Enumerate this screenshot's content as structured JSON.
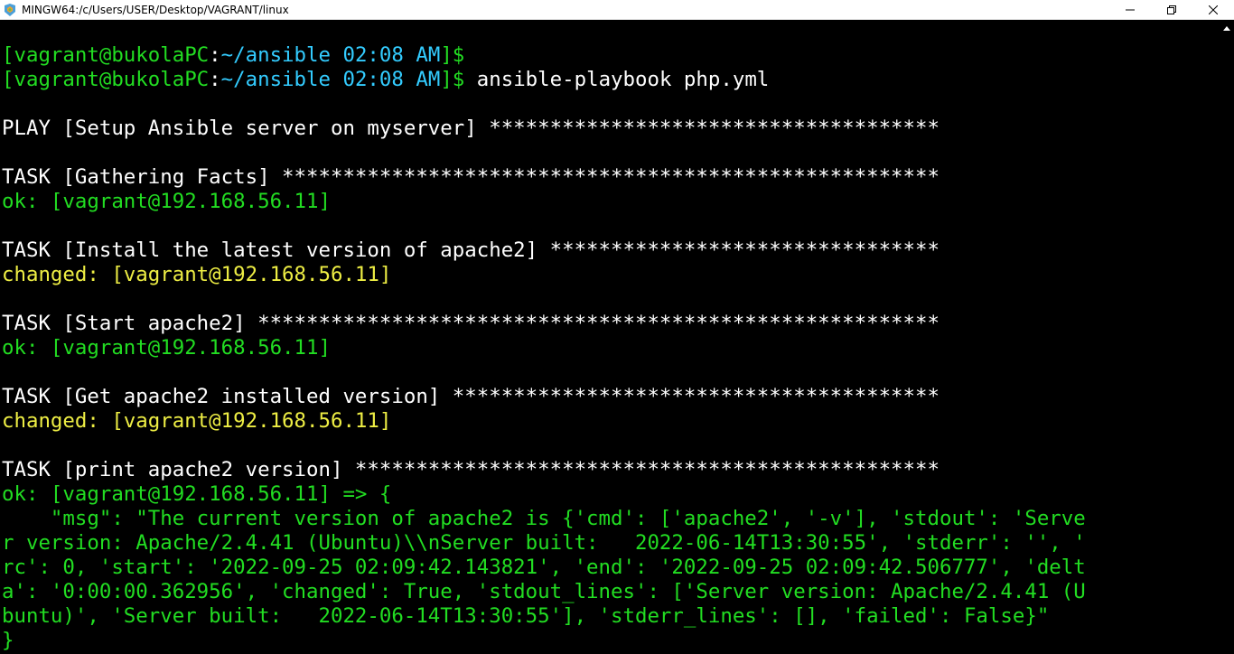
{
  "window": {
    "title": "MINGW64:/c/Users/USER/Desktop/VAGRANT/linux",
    "icon": "mingw-terminal-icon",
    "controls": [
      "minimize-icon",
      "restore-icon",
      "close-icon"
    ]
  },
  "terminal": {
    "colors": {
      "background": "#000000",
      "default": "#ffffff",
      "green": "#22dd22",
      "cyan": "#33ccff",
      "yellow": "#eeee44"
    },
    "lines": [
      {
        "name": "prompt-line",
        "segments": [
          {
            "text": "[vagrant@bukolaPC",
            "color": "green"
          },
          {
            "text": ":",
            "color": "white"
          },
          {
            "text": "~/ansible 02:08 AM",
            "color": "cyan"
          },
          {
            "text": "]$",
            "color": "green"
          }
        ]
      },
      {
        "name": "prompt-command-line",
        "segments": [
          {
            "text": "[vagrant@bukolaPC",
            "color": "green"
          },
          {
            "text": ":",
            "color": "white"
          },
          {
            "text": "~/ansible 02:08 AM",
            "color": "cyan"
          },
          {
            "text": "]$",
            "color": "green"
          },
          {
            "text": " ansible-playbook php.yml",
            "color": "white"
          }
        ]
      },
      {
        "name": "blank-line",
        "segments": []
      },
      {
        "name": "play-header",
        "segments": [
          {
            "text": "PLAY [Setup Ansible server on myserver] *************************************",
            "color": "white"
          }
        ]
      },
      {
        "name": "blank-line",
        "segments": []
      },
      {
        "name": "task-header",
        "segments": [
          {
            "text": "TASK [Gathering Facts] ******************************************************",
            "color": "white"
          }
        ]
      },
      {
        "name": "task-result-ok",
        "segments": [
          {
            "text": "ok: [vagrant@192.168.56.11]",
            "color": "green"
          }
        ]
      },
      {
        "name": "blank-line",
        "segments": []
      },
      {
        "name": "task-header",
        "segments": [
          {
            "text": "TASK [Install the latest version of apache2] ********************************",
            "color": "white"
          }
        ]
      },
      {
        "name": "task-result-changed",
        "segments": [
          {
            "text": "changed: [vagrant@192.168.56.11]",
            "color": "yellow"
          }
        ]
      },
      {
        "name": "blank-line",
        "segments": []
      },
      {
        "name": "task-header",
        "segments": [
          {
            "text": "TASK [Start apache2] ********************************************************",
            "color": "white"
          }
        ]
      },
      {
        "name": "task-result-ok",
        "segments": [
          {
            "text": "ok: [vagrant@192.168.56.11]",
            "color": "green"
          }
        ]
      },
      {
        "name": "blank-line",
        "segments": []
      },
      {
        "name": "task-header",
        "segments": [
          {
            "text": "TASK [Get apache2 installed version] ****************************************",
            "color": "white"
          }
        ]
      },
      {
        "name": "task-result-changed",
        "segments": [
          {
            "text": "changed: [vagrant@192.168.56.11]",
            "color": "yellow"
          }
        ]
      },
      {
        "name": "blank-line",
        "segments": []
      },
      {
        "name": "task-header",
        "segments": [
          {
            "text": "TASK [print apache2 version] ************************************************",
            "color": "white"
          }
        ]
      },
      {
        "name": "task-result-ok",
        "segments": [
          {
            "text": "ok: [vagrant@192.168.56.11] => {",
            "color": "green"
          }
        ]
      },
      {
        "name": "debug-output-line",
        "segments": [
          {
            "text": "    \"msg\": \"The current version of apache2 is {'cmd': ['apache2', '-v'], 'stdout': 'Serve",
            "color": "green"
          }
        ]
      },
      {
        "name": "debug-output-line",
        "segments": [
          {
            "text": "r version: Apache/2.4.41 (Ubuntu)\\\\nServer built:   2022-06-14T13:30:55', 'stderr': '', '",
            "color": "green"
          }
        ]
      },
      {
        "name": "debug-output-line",
        "segments": [
          {
            "text": "rc': 0, 'start': '2022-09-25 02:09:42.143821', 'end': '2022-09-25 02:09:42.506777', 'delt",
            "color": "green"
          }
        ]
      },
      {
        "name": "debug-output-line",
        "segments": [
          {
            "text": "a': '0:00:00.362956', 'changed': True, 'stdout_lines': ['Server version: Apache/2.4.41 (U",
            "color": "green"
          }
        ]
      },
      {
        "name": "debug-output-line",
        "segments": [
          {
            "text": "buntu)', 'Server built:   2022-06-14T13:30:55'], 'stderr_lines': [], 'failed': False}\"",
            "color": "green"
          }
        ]
      },
      {
        "name": "debug-output-line",
        "segments": [
          {
            "text": "}",
            "color": "green"
          }
        ]
      }
    ]
  }
}
